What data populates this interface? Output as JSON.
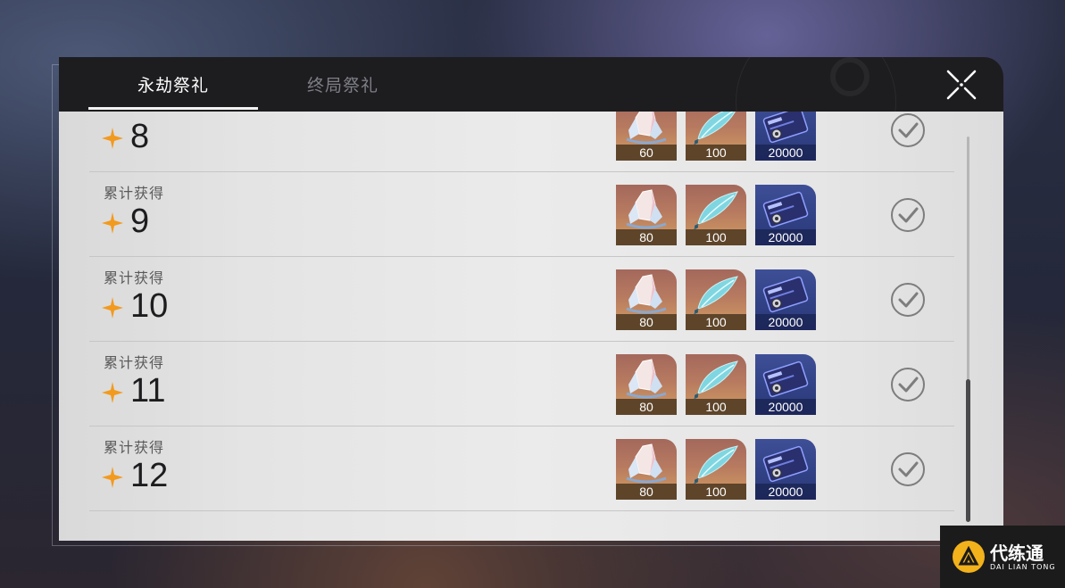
{
  "tabs": [
    {
      "label": "永劫祭礼",
      "active": true
    },
    {
      "label": "终局祭礼",
      "active": false
    }
  ],
  "rows": [
    {
      "label": "",
      "number": "8",
      "items": [
        {
          "qty": "60"
        },
        {
          "qty": "100"
        },
        {
          "qty": "20000"
        }
      ],
      "claimed": true
    },
    {
      "label": "累计获得",
      "number": "9",
      "items": [
        {
          "qty": "80"
        },
        {
          "qty": "100"
        },
        {
          "qty": "20000"
        }
      ],
      "claimed": true
    },
    {
      "label": "累计获得",
      "number": "10",
      "items": [
        {
          "qty": "80"
        },
        {
          "qty": "100"
        },
        {
          "qty": "20000"
        }
      ],
      "claimed": true
    },
    {
      "label": "累计获得",
      "number": "11",
      "items": [
        {
          "qty": "80"
        },
        {
          "qty": "100"
        },
        {
          "qty": "20000"
        }
      ],
      "claimed": true
    },
    {
      "label": "累计获得",
      "number": "12",
      "items": [
        {
          "qty": "80"
        },
        {
          "qty": "100"
        },
        {
          "qty": "20000"
        }
      ],
      "claimed": true
    }
  ],
  "item_icons": [
    "crystal-icon",
    "feather-icon",
    "credit-card-icon"
  ],
  "watermark": {
    "cn": "代练通",
    "en": "DAI LIAN TONG"
  },
  "colors": {
    "star": "#f29a1e",
    "header_bg": "#1d1d20",
    "content_bg": "#e8e8e8"
  },
  "scroll": {
    "position_fraction": 0.75
  }
}
